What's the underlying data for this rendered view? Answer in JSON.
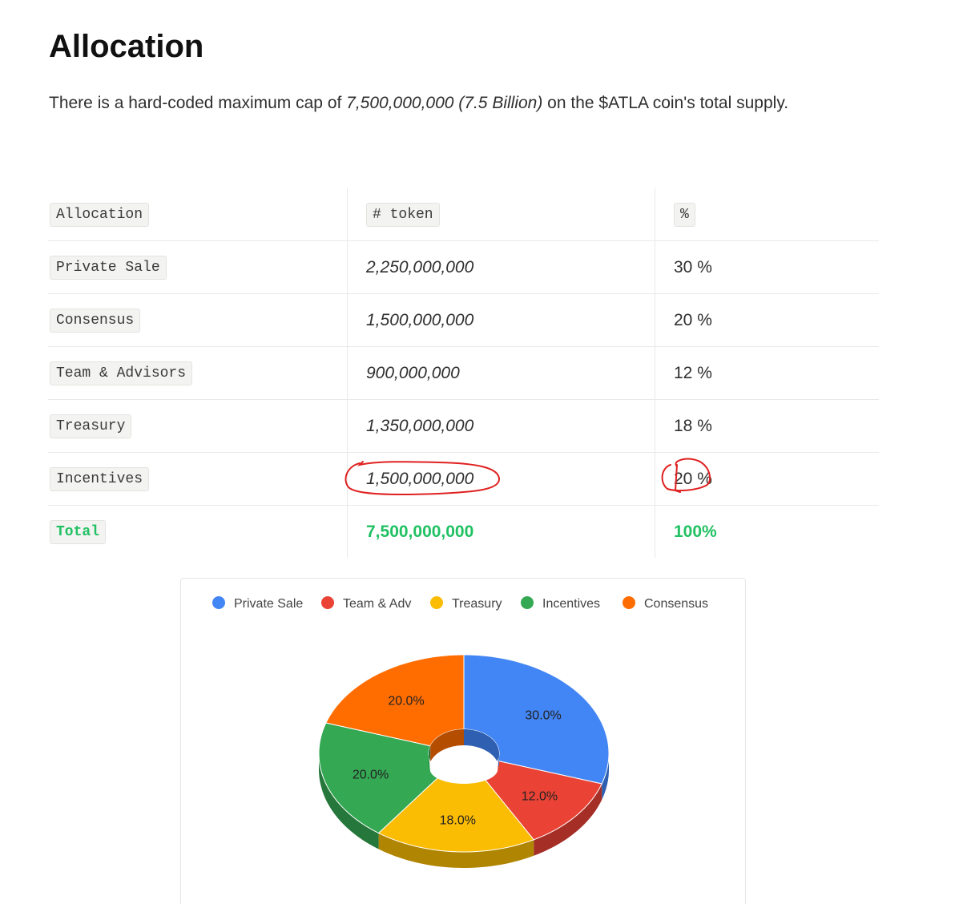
{
  "heading": "Allocation",
  "intro": {
    "before": "There is a hard-coded maximum cap of ",
    "emphasis": "7,500,000,000 (7.5 Billion)",
    "after": " on the $ATLA coin's total supply."
  },
  "table": {
    "headers": [
      "Allocation",
      "# token",
      "%"
    ],
    "rows": [
      {
        "name": "Private Sale",
        "tokens": "2,250,000,000",
        "pct": "30 %"
      },
      {
        "name": "Consensus",
        "tokens": "1,500,000,000",
        "pct": "20 %"
      },
      {
        "name": "Team & Advisors",
        "tokens": "900,000,000",
        "pct": "12 %"
      },
      {
        "name": "Treasury",
        "tokens": "1,350,000,000",
        "pct": "18 %"
      },
      {
        "name": "Incentives",
        "tokens": "1,500,000,000",
        "pct": "20 %"
      }
    ],
    "total": {
      "name": "Total",
      "tokens": "7,500,000,000",
      "pct": "100%"
    }
  },
  "annotation_color": "#e02020",
  "chart_data": {
    "type": "pie",
    "style": "3d-donut",
    "legend_position": "top",
    "slices": [
      {
        "name": "Private Sale",
        "value": 30.0,
        "label": "30.0%",
        "color": "#4285f4",
        "side": "#2f5fb0"
      },
      {
        "name": "Team & Adv",
        "value": 12.0,
        "label": "12.0%",
        "color": "#ea4335",
        "side": "#a52f27"
      },
      {
        "name": "Treasury",
        "value": 18.0,
        "label": "18.0%",
        "color": "#fbbc04",
        "side": "#b08502"
      },
      {
        "name": "Incentives",
        "value": 20.0,
        "label": "20.0%",
        "color": "#34a853",
        "side": "#25773b"
      },
      {
        "name": "Consensus",
        "value": 20.0,
        "label": "20.0%",
        "color": "#ff6d01",
        "side": "#b44d00"
      }
    ]
  }
}
